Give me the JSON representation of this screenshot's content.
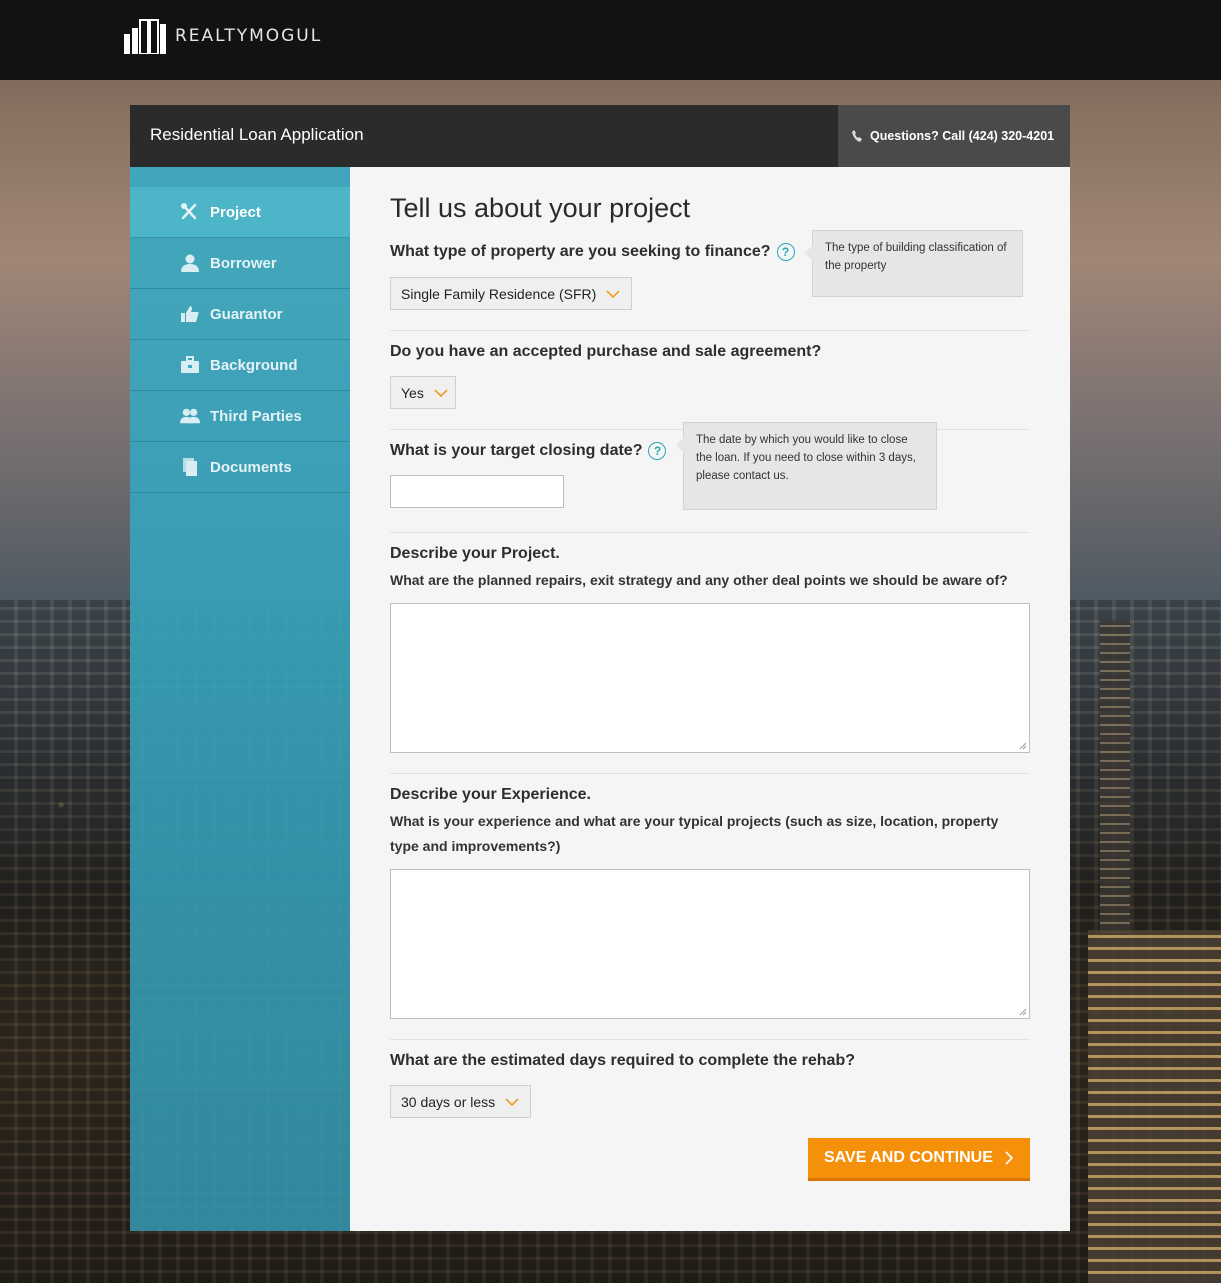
{
  "brand": {
    "name": "REALTYMOGUL"
  },
  "header": {
    "title": "Residential Loan Application",
    "help_text": "Questions? Call (424) 320-4201"
  },
  "sidebar": {
    "items": [
      {
        "label": "Project",
        "icon": "tools-icon",
        "active": true
      },
      {
        "label": "Borrower",
        "icon": "user-icon",
        "active": false
      },
      {
        "label": "Guarantor",
        "icon": "thumbs-up-icon",
        "active": false
      },
      {
        "label": "Background",
        "icon": "briefcase-icon",
        "active": false
      },
      {
        "label": "Third Parties",
        "icon": "users-icon",
        "active": false
      },
      {
        "label": "Documents",
        "icon": "documents-icon",
        "active": false
      }
    ]
  },
  "form": {
    "heading": "Tell us about your project",
    "property_type": {
      "question": "What type of property are you seeking to finance?",
      "value": "Single Family Residence (SFR)",
      "tooltip": "The type of building classification of the property"
    },
    "purchase_agreement": {
      "question": "Do you have an accepted purchase and sale agreement?",
      "value": "Yes"
    },
    "closing_date": {
      "question": "What is your target closing date?",
      "value": "",
      "tooltip": "The date by which you would like to close the loan. If you need to close within 3 days, please contact us."
    },
    "project": {
      "title": "Describe your Project.",
      "prompt": "What are the planned repairs, exit strategy and any other deal points we should be aware of?",
      "value": ""
    },
    "experience": {
      "title": "Describe your Experience.",
      "prompt": "What is your experience and what are your typical projects (such as size, location, property type and improvements?)",
      "value": ""
    },
    "rehab_days": {
      "question": "What are the estimated days required to complete the rehab?",
      "value": "30 days or less"
    },
    "submit_label": "SAVE AND CONTINUE"
  },
  "colors": {
    "accent": "#f5900a",
    "sidebar": "#3aaac2",
    "help_icon": "#2aa7b9"
  }
}
